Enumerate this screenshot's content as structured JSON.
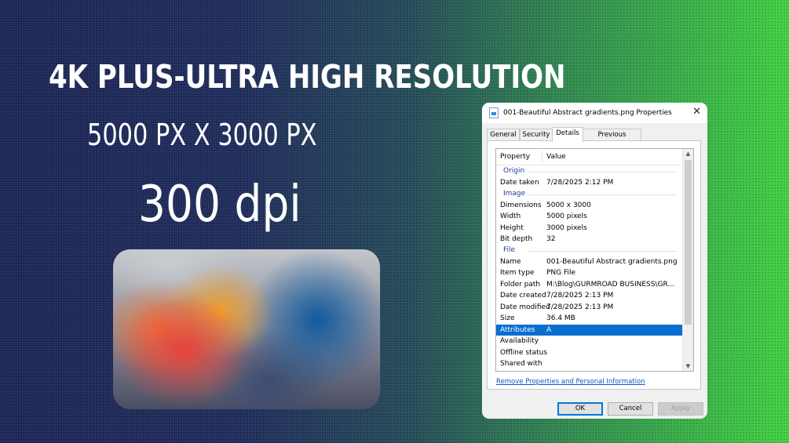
{
  "banner": {
    "headline": "4K PLUS-ULTRA HIGH RESOLUTION",
    "size_text": "5000 PX X 3000 PX",
    "dpi_text": "300 dpi"
  },
  "dialog": {
    "title": "001-Beautiful Abstract gradients.png Properties",
    "close_symbol": "✕",
    "tabs": [
      {
        "label": "General",
        "active": false
      },
      {
        "label": "Security",
        "active": false
      },
      {
        "label": "Details",
        "active": true
      },
      {
        "label": "Previous Versions",
        "active": false
      }
    ],
    "columns": {
      "property": "Property",
      "value": "Value"
    },
    "groups": {
      "origin": "Origin",
      "image": "Image",
      "file": "File"
    },
    "rows": {
      "date_taken": {
        "key": "Date taken",
        "value": "7/28/2025 2:12 PM"
      },
      "dimensions": {
        "key": "Dimensions",
        "value": "5000 x 3000"
      },
      "width": {
        "key": "Width",
        "value": "5000 pixels"
      },
      "height": {
        "key": "Height",
        "value": "3000 pixels"
      },
      "bit_depth": {
        "key": "Bit depth",
        "value": "32"
      },
      "name": {
        "key": "Name",
        "value": "001-Beautiful Abstract gradients.png"
      },
      "item_type": {
        "key": "Item type",
        "value": "PNG File"
      },
      "folder_path": {
        "key": "Folder path",
        "value": "M:\\Blog\\GURMROAD BUSINESS\\GR..."
      },
      "date_created": {
        "key": "Date created",
        "value": "7/28/2025 2:13 PM"
      },
      "date_modified": {
        "key": "Date modified",
        "value": "7/28/2025 2:13 PM"
      },
      "size": {
        "key": "Size",
        "value": "36.4 MB"
      },
      "attributes": {
        "key": "Attributes",
        "value": "A"
      },
      "availability": {
        "key": "Availability",
        "value": ""
      },
      "offline_status": {
        "key": "Offline status",
        "value": ""
      },
      "shared_with": {
        "key": "Shared with",
        "value": ""
      }
    },
    "remove_link": "Remove Properties and Personal Information",
    "buttons": {
      "ok": "OK",
      "cancel": "Cancel",
      "apply": "Apply"
    },
    "scroll_up": "▲",
    "scroll_down": "▼"
  },
  "colors": {
    "selection": "#0a6ed1",
    "group_header": "#1e3c96",
    "link": "#0b57c9"
  }
}
